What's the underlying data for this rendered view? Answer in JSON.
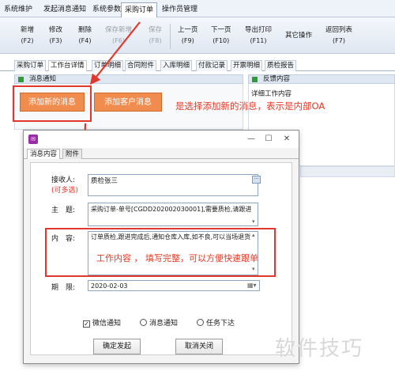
{
  "menu": {
    "items": [
      "系统维护",
      "发起消息通知",
      "系统参数",
      "采购订单",
      "操作员管理"
    ],
    "active_index": 3
  },
  "toolbar": {
    "buttons": [
      {
        "label": "新增",
        "key": "(F2)",
        "enabled": true
      },
      {
        "label": "修改",
        "key": "(F3)",
        "enabled": true
      },
      {
        "label": "删除",
        "key": "(F4)",
        "enabled": true
      },
      {
        "label": "保存新增",
        "key": "(F6)",
        "enabled": false
      },
      {
        "label": "保存",
        "key": "(F8)",
        "enabled": false
      },
      {
        "label": "上一页",
        "key": "(F9)",
        "enabled": true
      },
      {
        "label": "下一页",
        "key": "(F10)",
        "enabled": true
      },
      {
        "label": "导出打印",
        "key": "(F11)",
        "enabled": true
      },
      {
        "label": "其它操作",
        "key": "",
        "enabled": true
      },
      {
        "label": "返回列表",
        "key": "(F7)",
        "enabled": true
      }
    ]
  },
  "tabs": {
    "items": [
      "采购订单",
      "工作台详情",
      "订单明细",
      "合同附件",
      "入库明细",
      "付款记录",
      "开票明细",
      "质检报告"
    ],
    "active_index": 1
  },
  "left_panel": {
    "title": "消息通知",
    "add_new_button": "添加新的消息",
    "add_customer_button": "添加客户消息"
  },
  "right_panel": {
    "title": "反馈内容",
    "subtitle": "详细工作内容"
  },
  "annotations": {
    "top": "是选择添加新的消息，表示是内部OA",
    "middle": "工作内容 ， 填写完整，可以方便快速跟单"
  },
  "dialog": {
    "tabs": [
      "消息内容",
      "附件"
    ],
    "active_tab": 0,
    "recipient_label": "接收人:",
    "recipient_hint": "(可多选)",
    "recipient_value": "质检张三",
    "recipient_button": "···",
    "subject_label": "主　题:",
    "subject_value": "采购订单-单号[CGDD202002030001],需要质检,请跟进",
    "content_label": "内　容:",
    "content_value": "订单质检,跟进完成后,通知仓库入库,如不良,可以当场退货",
    "deadline_label": "期　限:",
    "deadline_value": "2020-02-03",
    "options": [
      {
        "label": "微信通知",
        "type": "checkbox",
        "checked": true
      },
      {
        "label": "消息通知",
        "type": "radio",
        "checked": false
      },
      {
        "label": "任务下达",
        "type": "radio",
        "checked": false
      }
    ],
    "confirm_button": "确定发起",
    "cancel_button": "取消关闭"
  },
  "watermark": "软件技巧",
  "colors": {
    "accent_orange": "#f08c4e",
    "annotation_red": "#e63a26",
    "panel_icon_green": "#2e9c38"
  }
}
